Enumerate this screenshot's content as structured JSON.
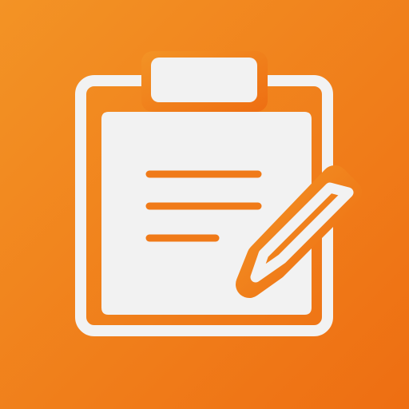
{
  "icon": {
    "subject": "clipboard-with-pencil-icon",
    "lines_shown": 3
  },
  "colors": {
    "background_start": "#F39325",
    "background_end": "#EE6E12",
    "foreground": "#F2F2F2",
    "accent_lines": "#F07A18"
  }
}
